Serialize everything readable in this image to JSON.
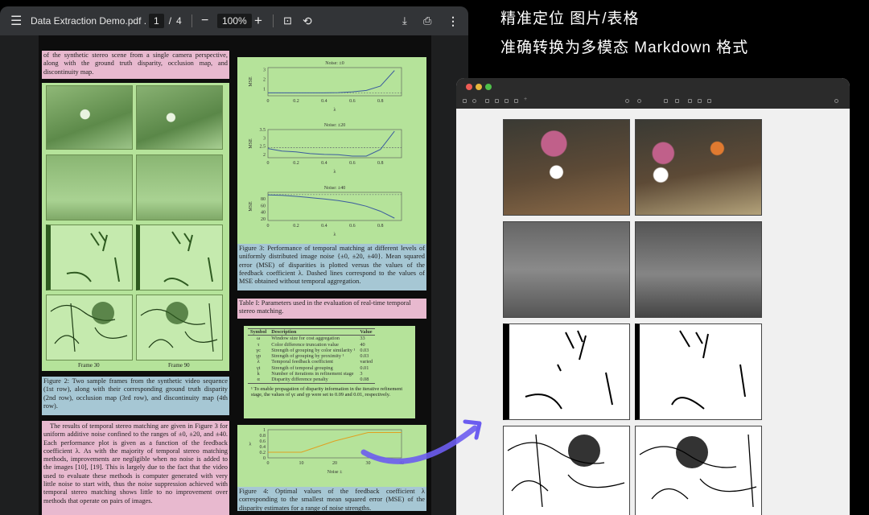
{
  "viewer": {
    "file_name": "Data Extraction Demo.pdf .",
    "current_page": "1",
    "page_sep": "/",
    "total_pages": "4",
    "zoom": "100%",
    "minus": "−",
    "plus": "+"
  },
  "headline": {
    "line1": "精准定位 图片/表格",
    "line2": "准确转换为多模态 Markdown 格式"
  },
  "left": {
    "intro": "of the synthetic stereo scene from a single camera perspective, along with the ground truth disparity, occlusion map, and discontinuity map.",
    "frame_labels": [
      "Frame 30",
      "Frame 90"
    ],
    "fig2_caption": "Figure 2: Two sample frames from the synthetic video sequence (1st row), along with their corresponding ground truth disparity (2nd row), occlusion map (3rd row), and discontinuity map (4th row).",
    "paragraph": "The results of temporal stereo matching are given in Figure 3 for uniform additive noise confined to the ranges of ±0, ±20, and ±40. Each performance plot is given as a function of the feedback coefficient λ. As with the majority of temporal stereo matching methods, improvements are negligible when no noise is added to the images [10], [19]. This is largely due to the fact that the video used to evaluate these methods is computer generated with very little noise to start with, thus the noise suppression achieved with temporal stereo matching shows little to no improvement over methods that operate on pairs of images."
  },
  "right": {
    "fig3_caption": "Figure 3: Performance of temporal matching at different levels of uniformly distributed image noise {±0, ±20, ±40}. Mean squared error (MSE) of disparities is plotted versus the values of the feedback coefficient λ. Dashed lines correspond to the values of MSE obtained without temporal aggregation.",
    "table_caption": "Table I: Parameters used in the evaluation of real-time temporal stereo matching.",
    "table": {
      "headers": [
        "Symbol",
        "Description",
        "Value"
      ],
      "rows": [
        [
          "ω",
          "Window size for cost aggregation",
          "33"
        ],
        [
          "τ",
          "Color difference truncation value",
          "40"
        ],
        [
          "γc",
          "Strength of grouping by color similarity ¹",
          "0.03"
        ],
        [
          "γp",
          "Strength of grouping by proximity ¹",
          "0.03"
        ],
        [
          "λ",
          "Temporal feedback coefficient",
          "varied"
        ],
        [
          "γt",
          "Strength of temporal grouping",
          "0.01"
        ],
        [
          "k",
          "Number of iterations in refinement stage",
          "3"
        ],
        [
          "α",
          "Disparity difference penalty",
          "0.08"
        ]
      ],
      "footnote": "¹ To enable propagation of disparity information in the iterative refinement stage, the values of γc and γp were set to 0.09 and 0.01, respectively."
    },
    "fig4_caption": "Figure 4: Optimal values of the feedback coefficient λ corresponding to the smallest mean squared error (MSE) of the disparity estimates for a range of noise strengths."
  },
  "chart_data": [
    {
      "type": "line",
      "title": "Noise: ±0",
      "xlabel": "λ",
      "ylabel": "MSE",
      "x": [
        0,
        0.1,
        0.2,
        0.3,
        0.4,
        0.5,
        0.6,
        0.7,
        0.8,
        0.9
      ],
      "values": [
        0.6,
        0.6,
        0.6,
        0.6,
        0.6,
        0.62,
        0.7,
        0.85,
        1.3,
        2.9
      ],
      "baseline": 0.6,
      "ylim": [
        0.3,
        3.2
      ],
      "xlim": [
        0,
        0.9
      ],
      "xticks": [
        "0",
        "0.2",
        "0.4",
        "0.6",
        "0.8"
      ],
      "yticks": [
        1,
        2,
        3
      ]
    },
    {
      "type": "line",
      "title": "Noise: ±20",
      "xlabel": "λ",
      "ylabel": "MSE",
      "x": [
        0,
        0.1,
        0.2,
        0.3,
        0.4,
        0.5,
        0.6,
        0.7,
        0.8,
        0.9
      ],
      "values": [
        2.35,
        2.2,
        2.15,
        2.05,
        2.0,
        1.98,
        1.9,
        1.9,
        2.3,
        3.4
      ],
      "baseline": 2.4,
      "ylim": [
        1.8,
        3.5
      ],
      "xlim": [
        0,
        0.9
      ],
      "xticks": [
        "0",
        "0.2",
        "0.4",
        "0.6",
        "0.8"
      ],
      "yticks": [
        2,
        2.5,
        3,
        3.5
      ]
    },
    {
      "type": "line",
      "title": "Noise: ±40",
      "xlabel": "λ",
      "ylabel": "MSE",
      "x": [
        0,
        0.1,
        0.2,
        0.3,
        0.4,
        0.5,
        0.6,
        0.7,
        0.8,
        0.9
      ],
      "values": [
        92,
        91,
        88,
        84,
        80,
        75,
        68,
        58,
        43,
        22
      ],
      "baseline": 93,
      "ylim": [
        15,
        100
      ],
      "xlim": [
        0,
        0.9
      ],
      "xticks": [
        "0",
        "0.2",
        "0.4",
        "0.6",
        "0.8"
      ],
      "yticks": [
        20,
        40,
        60,
        80
      ]
    },
    {
      "type": "line",
      "title": "",
      "xlabel": "Noise ±",
      "ylabel": "λ",
      "x": [
        0,
        10,
        20,
        30,
        40
      ],
      "values": [
        0.2,
        0.2,
        0.6,
        0.9,
        0.9
      ],
      "ylim": [
        0,
        1
      ],
      "xlim": [
        0,
        40
      ],
      "xticks": [
        "0",
        "10",
        "20",
        "30",
        "40"
      ],
      "yticks": [
        0,
        0.2,
        0.4,
        0.6,
        0.8,
        1
      ]
    }
  ],
  "colors": {
    "pink": "#e8b9cf",
    "green": "#b5e39a",
    "blue": "#a6c7d4",
    "arrow": "#6b5cf0"
  }
}
